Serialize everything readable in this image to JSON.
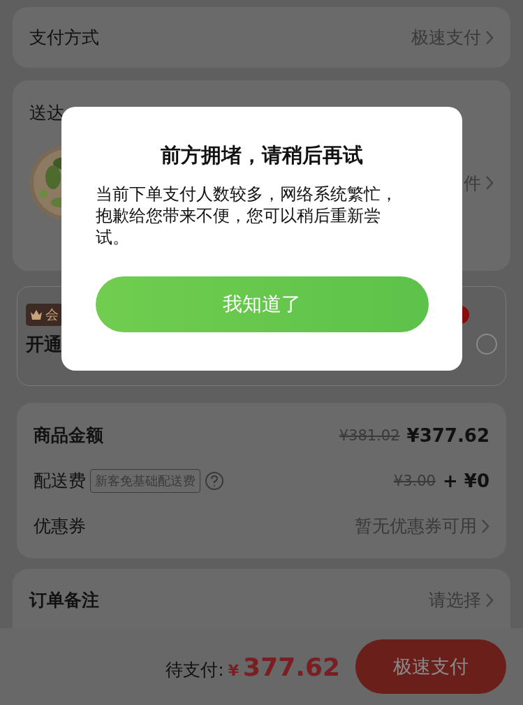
{
  "payment_method": {
    "label": "支付方式",
    "value": "极速支付"
  },
  "delivery": {
    "label": "送达",
    "item_count": "件"
  },
  "membership": {
    "badge": "会",
    "title": "开通",
    "selected": false
  },
  "price_summary": {
    "rows": [
      {
        "kind": "amount",
        "label": "商品金额",
        "original": "¥381.02",
        "value": "¥377.62"
      },
      {
        "kind": "fee",
        "label": "配送费",
        "tag": "新客免基础配送费",
        "original": "¥3.00",
        "value": "+ ¥0"
      },
      {
        "kind": "link",
        "label": "优惠券",
        "value": "暂无优惠券可用"
      }
    ]
  },
  "order_note": {
    "label": "订单备注",
    "value": "请选择"
  },
  "checkout_bar": {
    "label": "待支付:",
    "currency": "¥",
    "amount": "377.62",
    "button": "极速支付"
  },
  "dialog": {
    "title": "前方拥堵，请稍后再试",
    "message": "当前下单支付人数较多，网络系统繁忙，抱歉给您带来不便，您可以稍后重新尝试。",
    "button": "我知道了"
  }
}
